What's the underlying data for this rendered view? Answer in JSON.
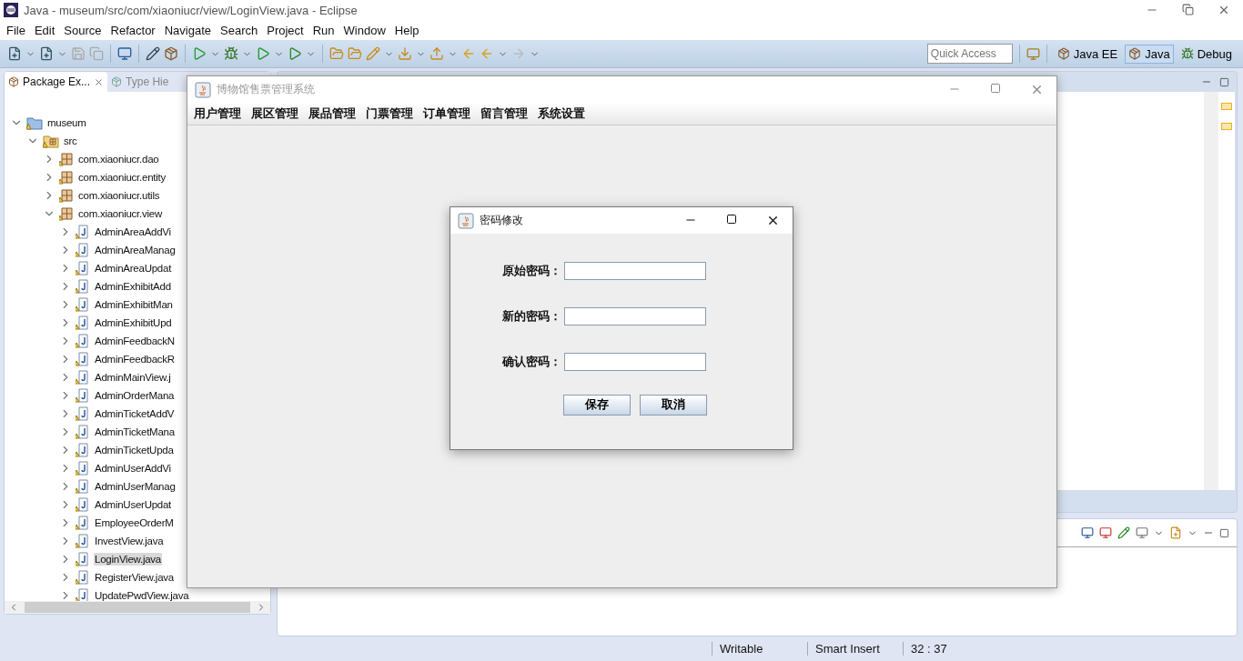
{
  "window": {
    "title": "Java - museum/src/com/xiaoniucr/view/LoginView.java - Eclipse"
  },
  "menu": [
    "File",
    "Edit",
    "Source",
    "Refactor",
    "Navigate",
    "Search",
    "Project",
    "Run",
    "Window",
    "Help"
  ],
  "toolbar": {
    "quick_access": {
      "placeholder": "Quick Access"
    },
    "perspectives": [
      {
        "label": "Java EE",
        "selected": false
      },
      {
        "label": "Java",
        "selected": true
      },
      {
        "label": "Debug",
        "selected": false
      }
    ]
  },
  "left_pane": {
    "tabs": [
      {
        "label": "Package Ex...",
        "selected": true
      },
      {
        "label": "Type Hie",
        "selected": false
      }
    ],
    "tree": [
      {
        "label": "museum",
        "kind": "project",
        "expanded": true,
        "selected": false,
        "children": [
          {
            "label": "src",
            "kind": "source",
            "expanded": true,
            "selected": false,
            "children": [
              {
                "label": "com.xiaoniucr.dao",
                "kind": "package",
                "expanded": false,
                "selected": false
              },
              {
                "label": "com.xiaoniucr.entity",
                "kind": "package",
                "expanded": false,
                "selected": false
              },
              {
                "label": "com.xiaoniucr.utils",
                "kind": "package",
                "expanded": false,
                "selected": false
              },
              {
                "label": "com.xiaoniucr.view",
                "kind": "package",
                "expanded": true,
                "selected": false,
                "children": [
                  {
                    "label": "AdminAreaAddVi",
                    "kind": "file",
                    "expanded": false,
                    "selected": false
                  },
                  {
                    "label": "AdminAreaManag",
                    "kind": "file",
                    "expanded": false,
                    "selected": false
                  },
                  {
                    "label": "AdminAreaUpdat",
                    "kind": "file",
                    "expanded": false,
                    "selected": false
                  },
                  {
                    "label": "AdminExhibitAdd",
                    "kind": "file",
                    "expanded": false,
                    "selected": false
                  },
                  {
                    "label": "AdminExhibitMan",
                    "kind": "file",
                    "expanded": false,
                    "selected": false
                  },
                  {
                    "label": "AdminExhibitUpd",
                    "kind": "file",
                    "expanded": false,
                    "selected": false
                  },
                  {
                    "label": "AdminFeedbackN",
                    "kind": "file",
                    "expanded": false,
                    "selected": false
                  },
                  {
                    "label": "AdminFeedbackR",
                    "kind": "file",
                    "expanded": false,
                    "selected": false
                  },
                  {
                    "label": "AdminMainView.j",
                    "kind": "file",
                    "expanded": false,
                    "selected": false
                  },
                  {
                    "label": "AdminOrderMana",
                    "kind": "file",
                    "expanded": false,
                    "selected": false
                  },
                  {
                    "label": "AdminTicketAddV",
                    "kind": "file",
                    "expanded": false,
                    "selected": false
                  },
                  {
                    "label": "AdminTicketMana",
                    "kind": "file",
                    "expanded": false,
                    "selected": false
                  },
                  {
                    "label": "AdminTicketUpda",
                    "kind": "file",
                    "expanded": false,
                    "selected": false
                  },
                  {
                    "label": "AdminUserAddVi",
                    "kind": "file",
                    "expanded": false,
                    "selected": false
                  },
                  {
                    "label": "AdminUserManag",
                    "kind": "file",
                    "expanded": false,
                    "selected": false
                  },
                  {
                    "label": "AdminUserUpdat",
                    "kind": "file",
                    "expanded": false,
                    "selected": false
                  },
                  {
                    "label": "EmployeeOrderM",
                    "kind": "file",
                    "expanded": false,
                    "selected": false
                  },
                  {
                    "label": "InvestView.java",
                    "kind": "file",
                    "expanded": false,
                    "selected": false
                  },
                  {
                    "label": "LoginView.java",
                    "kind": "file",
                    "expanded": false,
                    "selected": true
                  },
                  {
                    "label": "RegisterView.java",
                    "kind": "file",
                    "expanded": false,
                    "selected": false
                  },
                  {
                    "label": "UpdatePwdView.java",
                    "kind": "file",
                    "expanded": false,
                    "selected": false
                  }
                ]
              }
            ]
          }
        ]
      }
    ]
  },
  "app_window": {
    "title": "博物馆售票管理系统",
    "menu": [
      "用户管理",
      "展区管理",
      "展品管理",
      "门票管理",
      "订单管理",
      "留言管理",
      "系统设置"
    ]
  },
  "dialog": {
    "title": "密码修改",
    "fields": [
      {
        "label": "原始密码："
      },
      {
        "label": "新的密码："
      },
      {
        "label": "确认密码："
      }
    ],
    "buttons": [
      "保存",
      "取消"
    ]
  },
  "status_bar": [
    "Writable",
    "Smart Insert",
    "32 : 37"
  ]
}
